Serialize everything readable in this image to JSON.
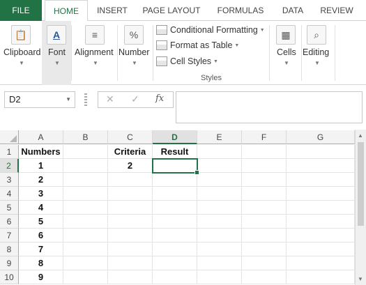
{
  "ribbon_tabs": [
    "FILE",
    "HOME",
    "INSERT",
    "PAGE LAYOUT",
    "FORMULAS",
    "DATA",
    "REVIEW"
  ],
  "active_tab": "HOME",
  "ribbon": {
    "clipboard": "Clipboard",
    "font": "Font",
    "alignment": "Alignment",
    "number": "Number",
    "conditional_formatting": "Conditional Formatting",
    "format_as_table": "Format as Table",
    "cell_styles": "Cell Styles",
    "styles_group": "Styles",
    "cells": "Cells",
    "editing": "Editing"
  },
  "formula_bar": {
    "name_box": "D2",
    "cancel_icon": "✕",
    "enter_icon": "✓",
    "function_icon": "fx",
    "formula": ""
  },
  "sheet": {
    "columns": [
      "A",
      "B",
      "C",
      "D",
      "E",
      "F",
      "G"
    ],
    "selected_column": "D",
    "rows": [
      "1",
      "2",
      "3",
      "4",
      "5",
      "6",
      "7",
      "8",
      "9",
      "10"
    ],
    "selected_row": "2",
    "cells": {
      "A1": "Numbers",
      "C1": "Criteria",
      "D1": "Result",
      "A2": "1",
      "C2": "2",
      "A3": "2",
      "A4": "3",
      "A5": "4",
      "A6": "5",
      "A7": "6",
      "A8": "7",
      "A9": "8",
      "A10": "9"
    },
    "active_cell": "D2"
  },
  "colors": {
    "accent": "#217346"
  }
}
